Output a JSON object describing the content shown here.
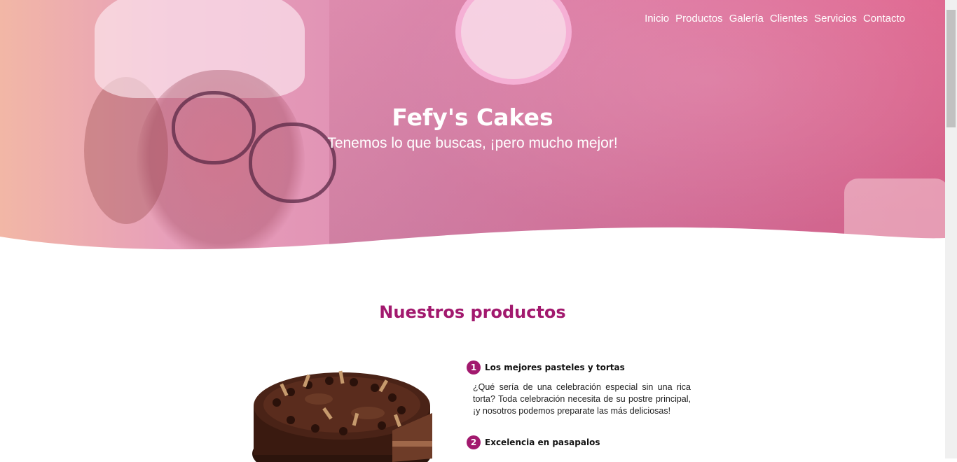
{
  "nav": {
    "items": [
      "Inicio",
      "Productos",
      "Galería",
      "Clientes",
      "Servicios",
      "Contacto"
    ]
  },
  "hero": {
    "title": "Fefy's Cakes",
    "subtitle": "Tenemos lo que buscas, ¡pero mucho mejor!"
  },
  "products": {
    "title": "Nuestros productos",
    "features": [
      {
        "num": "1",
        "title": "Los mejores pasteles y tortas",
        "text": "¿Qué sería de una celebración especial sin una rica torta? Toda celebración necesita de su postre principal, ¡y nosotros podemos preparate las más deliciosas!"
      },
      {
        "num": "2",
        "title": "Excelencia en pasapalos"
      }
    ]
  },
  "colors": {
    "accent": "#a2196e",
    "hero_gradient_start": "#f2b7a6",
    "hero_gradient_end": "#e46d95"
  }
}
